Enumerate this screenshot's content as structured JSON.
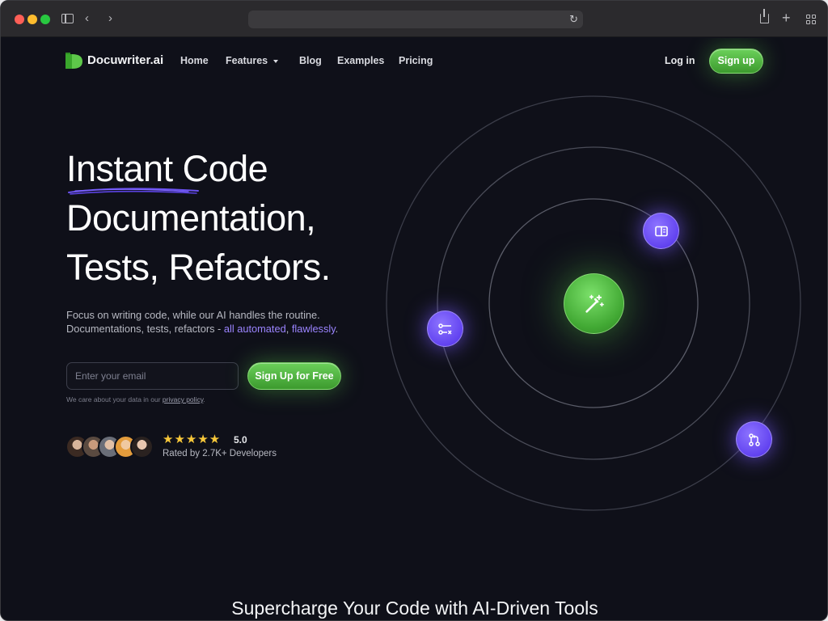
{
  "nav": {
    "brand": "Docuwriter.ai",
    "links": [
      "Home",
      "Features",
      "Blog",
      "Examples",
      "Pricing"
    ],
    "login": "Log in",
    "signup": "Sign up"
  },
  "hero": {
    "headline_line1_word1": "Instant",
    "headline_line1_word2": "Code",
    "headline_line2": "Documentation,",
    "headline_line3": "Tests, Refactors.",
    "sub_line1": "Focus on writing code, while our AI handles the routine.",
    "sub_line2_prefix": "Documentations, tests, refactors - ",
    "sub_line2_accent1": "all automated",
    "sub_line2_sep": ", ",
    "sub_line2_accent2": "flawlessly",
    "sub_line2_suffix": ".",
    "email_placeholder": "Enter your email",
    "cta": "Sign Up for Free",
    "privacy_prefix": "We care about your data in our ",
    "privacy_link": "privacy policy",
    "privacy_suffix": ".",
    "stars": "★★★★★",
    "rating": "5.0",
    "rated_by": "Rated by 2.7K+ Developers"
  },
  "orbit_icons": {
    "center": "magic-wand-icon",
    "top": "book-icon",
    "left": "git-compare-icon",
    "right": "git-pull-request-icon"
  },
  "section_title": "Supercharge Your Code with AI-Driven Tools",
  "colors": {
    "background": "#0f1019",
    "accent_green": "#4caf3a",
    "accent_purple": "#6e55f5",
    "accent_text": "#9b84ff",
    "star": "#f8c83a"
  }
}
